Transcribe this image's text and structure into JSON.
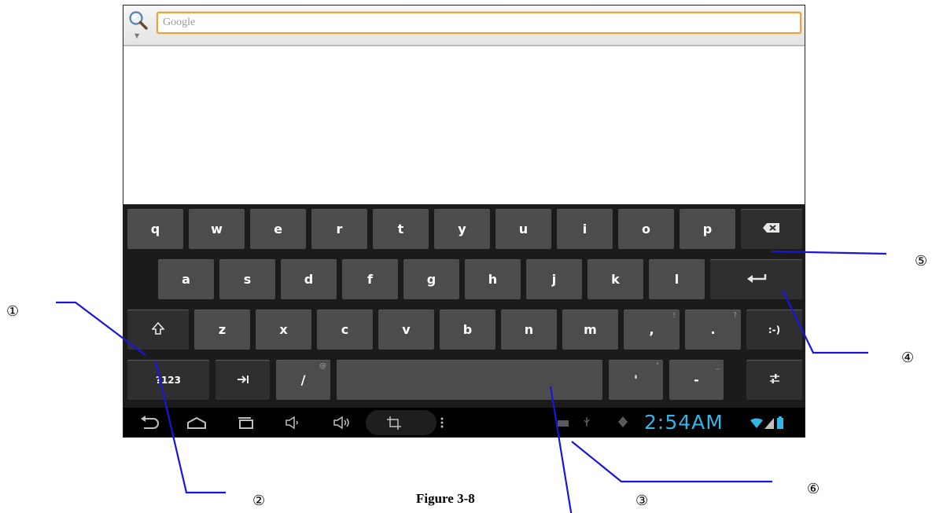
{
  "search": {
    "placeholder": "Google"
  },
  "keyboard": {
    "row1": [
      "q",
      "w",
      "e",
      "r",
      "t",
      "y",
      "u",
      "i",
      "o",
      "p"
    ],
    "row2": [
      "a",
      "s",
      "d",
      "f",
      "g",
      "h",
      "j",
      "k",
      "l"
    ],
    "row3": [
      "z",
      "x",
      "c",
      "v",
      "b",
      "n",
      "m"
    ],
    "comma": ",",
    "comma_hint": "!",
    "period": ".",
    "period_hint": "?",
    "smiley": ":-)",
    "symbols_label": "?123",
    "slash": "/",
    "slash_hint": "@",
    "apostrophe": "'",
    "apostrophe_hint": "\"",
    "dash": "-",
    "dash_hint": "_"
  },
  "status": {
    "time": "2:54AM"
  },
  "callouts": {
    "c1": "①",
    "c2": "②",
    "c3": "③",
    "c4": "④",
    "c5": "⑤",
    "c6": "⑥"
  },
  "caption": "Figure 3-8",
  "colors": {
    "accent_line": "#1a14e0",
    "clock": "#33b5e5",
    "search_border": "#e8a33c",
    "key": "#4c4c4c"
  }
}
